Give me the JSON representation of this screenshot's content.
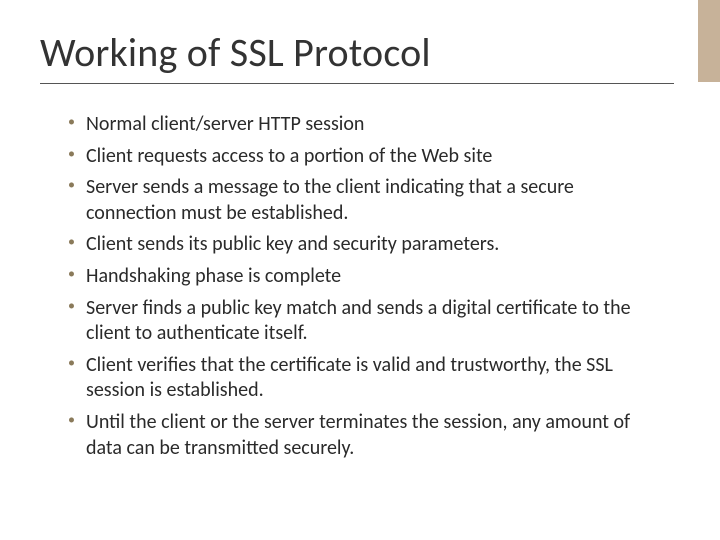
{
  "accent_color": "#c7b299",
  "title": "Working of SSL Protocol",
  "bullets": [
    "Normal client/server HTTP session",
    "Client requests access to a portion of the Web site",
    "Server sends a message to the client indicating that a secure connection must be established.",
    "Client sends its public key and security parameters.",
    "Handshaking phase is complete",
    "Server finds a public key match and sends a digital certificate to the client to authenticate itself.",
    "Client verifies that the certificate is valid and trustworthy, the SSL session is established.",
    "Until the client or the server terminates the session, any amount of data can be transmitted securely."
  ]
}
